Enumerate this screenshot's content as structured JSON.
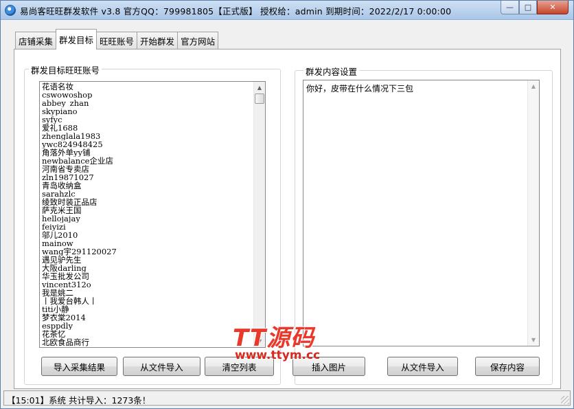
{
  "window": {
    "title": "易尚客旺旺群发软件 v3.8 官方QQ：799981805【正式版】 授权给：admin  到期时间：2022/2/17 0:00:00",
    "min_glyph": "—",
    "max_glyph": "□",
    "close_glyph": "✕"
  },
  "tabs": [
    {
      "label": "店铺采集"
    },
    {
      "label": "群发目标"
    },
    {
      "label": "旺旺账号"
    },
    {
      "label": "开始群发"
    },
    {
      "label": "官方网站"
    }
  ],
  "targets": {
    "group_label": "群发目标旺旺账号",
    "items": [
      "花语名妆",
      "cswowoshop",
      "abbey_zhan",
      "skypiano",
      "syfyc",
      "爱礼1688",
      "zhenglala1983",
      "ywc824948425",
      "角落外单yy铺",
      "newbalance企业店",
      "河南省专卖店",
      "zln19871027",
      "青岛收纳盒",
      "sarahzlc",
      "绫致时装正品店",
      "萨克米王国",
      "hellojajay",
      "feiyizi",
      "邬儿2010",
      "mainow",
      "wang宇291120027",
      "遇见驴先生",
      "大阪darling",
      "华玉批发公司",
      "vincent312o",
      "我是姚二",
      "丨我爱台韩人丨",
      "titi小静",
      "梦衣棠2014",
      "esppdly",
      "花茶忆",
      "北欧食品商行"
    ],
    "scroll_up": "▲",
    "scroll_down": "▼"
  },
  "content": {
    "group_label": "群发内容设置",
    "text": "你好，皮带在什么情况下三包",
    "scroll_up": "▲",
    "scroll_down": "▼"
  },
  "buttons": {
    "import_collected": "导入采集结果",
    "import_file_left": "从文件导入",
    "clear_list": "清空列表",
    "insert_image": "插入图片",
    "import_file_right": "从文件导入",
    "save_content": "保存内容"
  },
  "status": {
    "text": "【15:01】系统 共计导入：1273条！"
  },
  "watermark": {
    "top": "TT源码",
    "bottom": "www.ttym.cc"
  }
}
